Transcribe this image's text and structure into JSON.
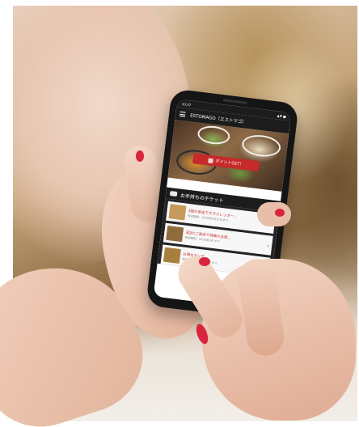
{
  "app": {
    "status_time": "10:37",
    "status_right": "▲▼ ■",
    "title": "ESTOMAGO（エストマゴ）",
    "point_button_label": "ポイントGET！",
    "section_title": "お手持ちのチケット",
    "coupons": [
      {
        "title": "3回の来店でサラクレッター…",
        "sub": "有効期限：2019年5月31日まで",
        "thumb_color": "#c79a5b"
      },
      {
        "title": "3回のご来店で特典の全部…",
        "sub": "有効期限：2019年6月 まで",
        "thumb_color": "#8f6b3e"
      },
      {
        "title": "お得なランチ…",
        "sub": "有効期限：2019年6月 まで",
        "thumb_color": "#a8803d"
      }
    ],
    "chevron": "›"
  },
  "colors": {
    "accent": "#c62a2a",
    "header": "#1c1c1c",
    "nail": "#d8243f"
  }
}
